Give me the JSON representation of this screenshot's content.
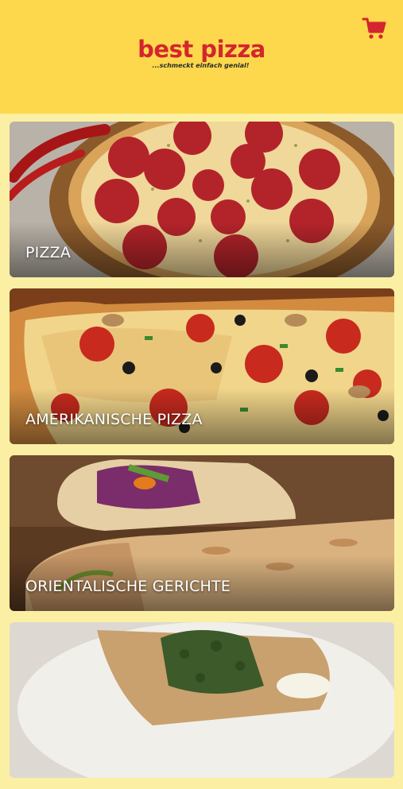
{
  "header": {
    "brand_name": "best pizza",
    "tagline": "...schmeckt einfach genial!",
    "cart_icon": "shopping-cart-icon"
  },
  "colors": {
    "header_bg": "#fdd84c",
    "page_bg": "#fbefa3",
    "brand_red": "#d3262e"
  },
  "categories": [
    {
      "label": "PIZZA"
    },
    {
      "label": "AMERIKANISCHE PIZZA"
    },
    {
      "label": "ORIENTALISCHE GERICHTE"
    },
    {
      "label": ""
    }
  ]
}
